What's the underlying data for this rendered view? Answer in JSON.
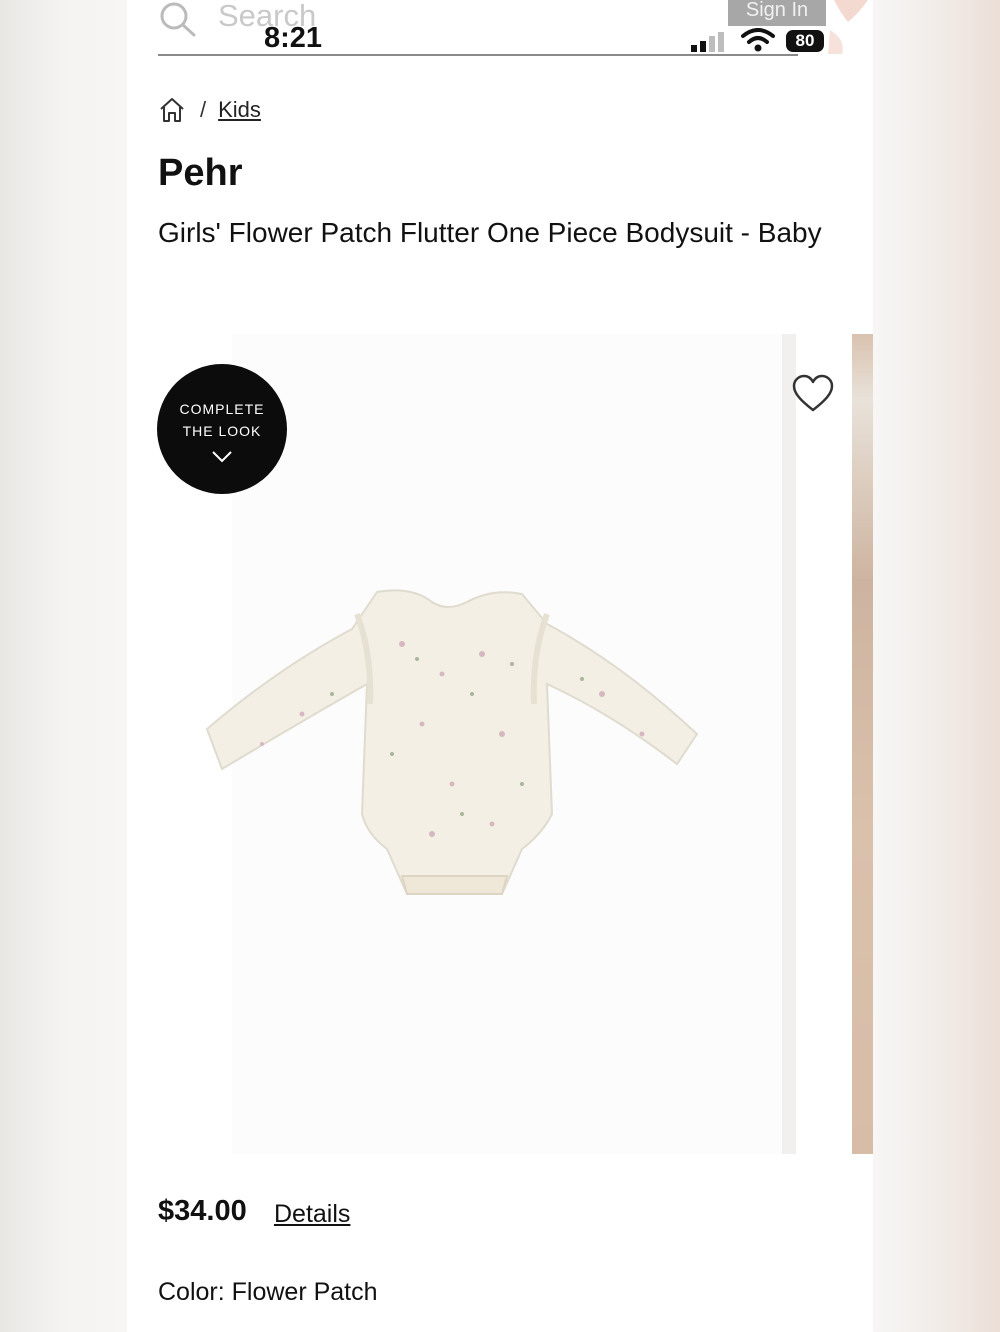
{
  "header": {
    "search_placeholder": "Search",
    "sign_in_label": "Sign In"
  },
  "status_bar": {
    "time": "8:21",
    "battery": "80"
  },
  "breadcrumb": {
    "separator": "/",
    "current": "Kids"
  },
  "product": {
    "brand": "Pehr",
    "title": "Girls' Flower Patch Flutter One Piece Bodysuit - Baby",
    "complete_look_line1": "COMPLETE",
    "complete_look_line2": "THE LOOK",
    "price": "$34.00",
    "details_label": "Details",
    "color_label": "Color:",
    "color_value": "Flower Patch"
  }
}
